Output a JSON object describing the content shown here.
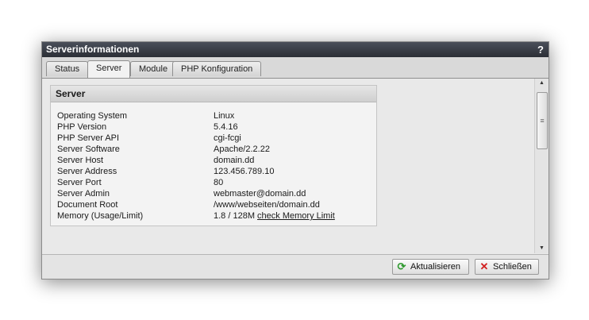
{
  "window": {
    "title": "Serverinformationen",
    "help_label": "?"
  },
  "tabs": [
    {
      "label": "Status"
    },
    {
      "label": "Server"
    },
    {
      "label": "Module"
    },
    {
      "label": "PHP Konfiguration"
    }
  ],
  "active_tab": "Server",
  "panel": {
    "title": "Server",
    "rows": [
      {
        "label": "Operating System",
        "value": "Linux"
      },
      {
        "label": "PHP Version",
        "value": "5.4.16"
      },
      {
        "label": "PHP Server API",
        "value": "cgi-fcgi"
      },
      {
        "label": "Server Software",
        "value": "Apache/2.2.22"
      },
      {
        "label": "Server Host",
        "value": "domain.dd"
      },
      {
        "label": "Server Address",
        "value": "123.456.789.10"
      },
      {
        "label": "Server Port",
        "value": "80"
      },
      {
        "label": "Server Admin",
        "value": "webmaster@domain.dd"
      },
      {
        "label": "Document Root",
        "value": "/www/webseiten/domain.dd"
      },
      {
        "label": "Memory (Usage/Limit)",
        "value": "1.8 / 128M",
        "link": "check Memory Limit"
      }
    ]
  },
  "footer": {
    "refresh_label": "Aktualisieren",
    "close_label": "Schließen"
  },
  "icons": {
    "refresh": "refresh-icon",
    "close": "close-icon"
  }
}
